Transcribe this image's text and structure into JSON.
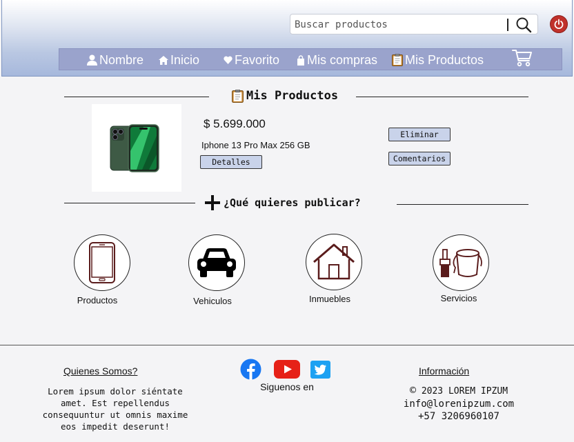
{
  "header": {
    "search": {
      "placeholder": "Buscar productos"
    },
    "nav": [
      {
        "label": "Nombre",
        "icon": "user-icon"
      },
      {
        "label": "Inicio",
        "icon": "home-icon"
      },
      {
        "label": "Favorito",
        "icon": "heart-icon"
      },
      {
        "label": "Mis compras",
        "icon": "shopping-bag-icon"
      },
      {
        "label": "Mis Productos",
        "icon": "clipboard-icon"
      }
    ],
    "cart_icon": "cart-icon",
    "power_icon": "power-icon"
  },
  "my_products": {
    "title": "Mis Productos",
    "items": [
      {
        "price": "$ 5.699.000",
        "name": "Iphone 13 Pro Max 256 GB",
        "details_label": "Detalles",
        "delete_label": "Eliminar",
        "comments_label": "Comentarios"
      }
    ]
  },
  "publish": {
    "title": "¿Qué quieres publicar?",
    "categories": [
      {
        "label": "Productos",
        "icon": "phone-icon"
      },
      {
        "label": "Vehiculos",
        "icon": "car-icon"
      },
      {
        "label": "Inmuebles",
        "icon": "house-icon"
      },
      {
        "label": "Servicios",
        "icon": "paint-bucket-icon"
      }
    ]
  },
  "footer": {
    "about_title": "Quienes Somos?",
    "about_text": "Lorem ipsum dolor siéntate amet. Est repellendus consequuntur ut omnis maxime eos impedit deserunt!",
    "social_label": "Siguenos en",
    "info_title": "Información",
    "copyright": "2023 LOREM IPZUM",
    "email": "info@lorenipzum.com",
    "phone": "+57 3206960107"
  },
  "colors": {
    "navbar": "#9aa3cc",
    "button": "#c9d3ea",
    "power": "#c0312b",
    "facebook": "#1877f2",
    "youtube": "#e62117",
    "twitter": "#1da1f2"
  }
}
